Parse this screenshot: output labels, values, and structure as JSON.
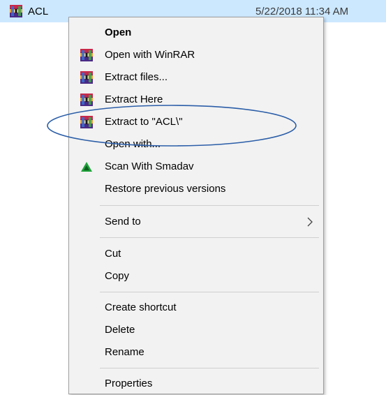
{
  "file": {
    "name": "ACL",
    "date": "5/22/2018 11:34 AM"
  },
  "menu": {
    "items": [
      {
        "label": "Open",
        "icon": "none"
      },
      {
        "label": "Open with WinRAR",
        "icon": "winrar-icon"
      },
      {
        "label": "Extract files...",
        "icon": "winrar-icon"
      },
      {
        "label": "Extract Here",
        "icon": "winrar-icon"
      },
      {
        "label": "Extract to \"ACL\\\"",
        "icon": "winrar-icon"
      },
      {
        "label": "Open with...",
        "icon": "none"
      },
      {
        "label": "Scan With Smadav",
        "icon": "smadav-icon"
      },
      {
        "label": "Restore previous versions",
        "icon": "none"
      },
      {
        "label": "Send to",
        "icon": "none"
      },
      {
        "label": "Cut",
        "icon": "none"
      },
      {
        "label": "Copy",
        "icon": "none"
      },
      {
        "label": "Create shortcut",
        "icon": "none"
      },
      {
        "label": "Delete",
        "icon": "none"
      },
      {
        "label": "Rename",
        "icon": "none"
      },
      {
        "label": "Properties",
        "icon": "none"
      }
    ]
  },
  "colors": {
    "selection_row": "#cce8ff",
    "menu_bg": "#f2f2f2",
    "annotation_oval": "#2b5ea8"
  }
}
